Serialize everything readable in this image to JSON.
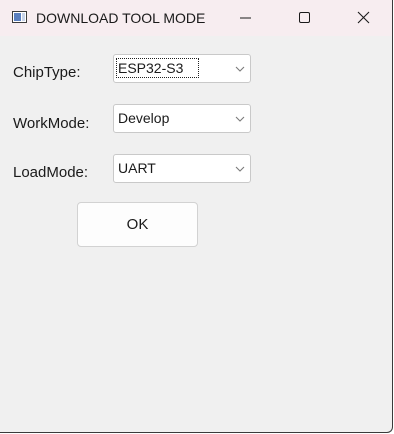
{
  "window": {
    "title": "DOWNLOAD TOOL MODE"
  },
  "form": {
    "chip_type": {
      "label": "ChipType:",
      "value": "ESP32-S3"
    },
    "work_mode": {
      "label": "WorkMode:",
      "value": "Develop"
    },
    "load_mode": {
      "label": "LoadMode:",
      "value": "UART"
    },
    "ok_label": "OK"
  },
  "icons": {
    "app": "app-window-icon",
    "minimize": "minimize-icon",
    "maximize": "maximize-icon",
    "close": "close-icon",
    "dropdown": "chevron-down-icon"
  }
}
